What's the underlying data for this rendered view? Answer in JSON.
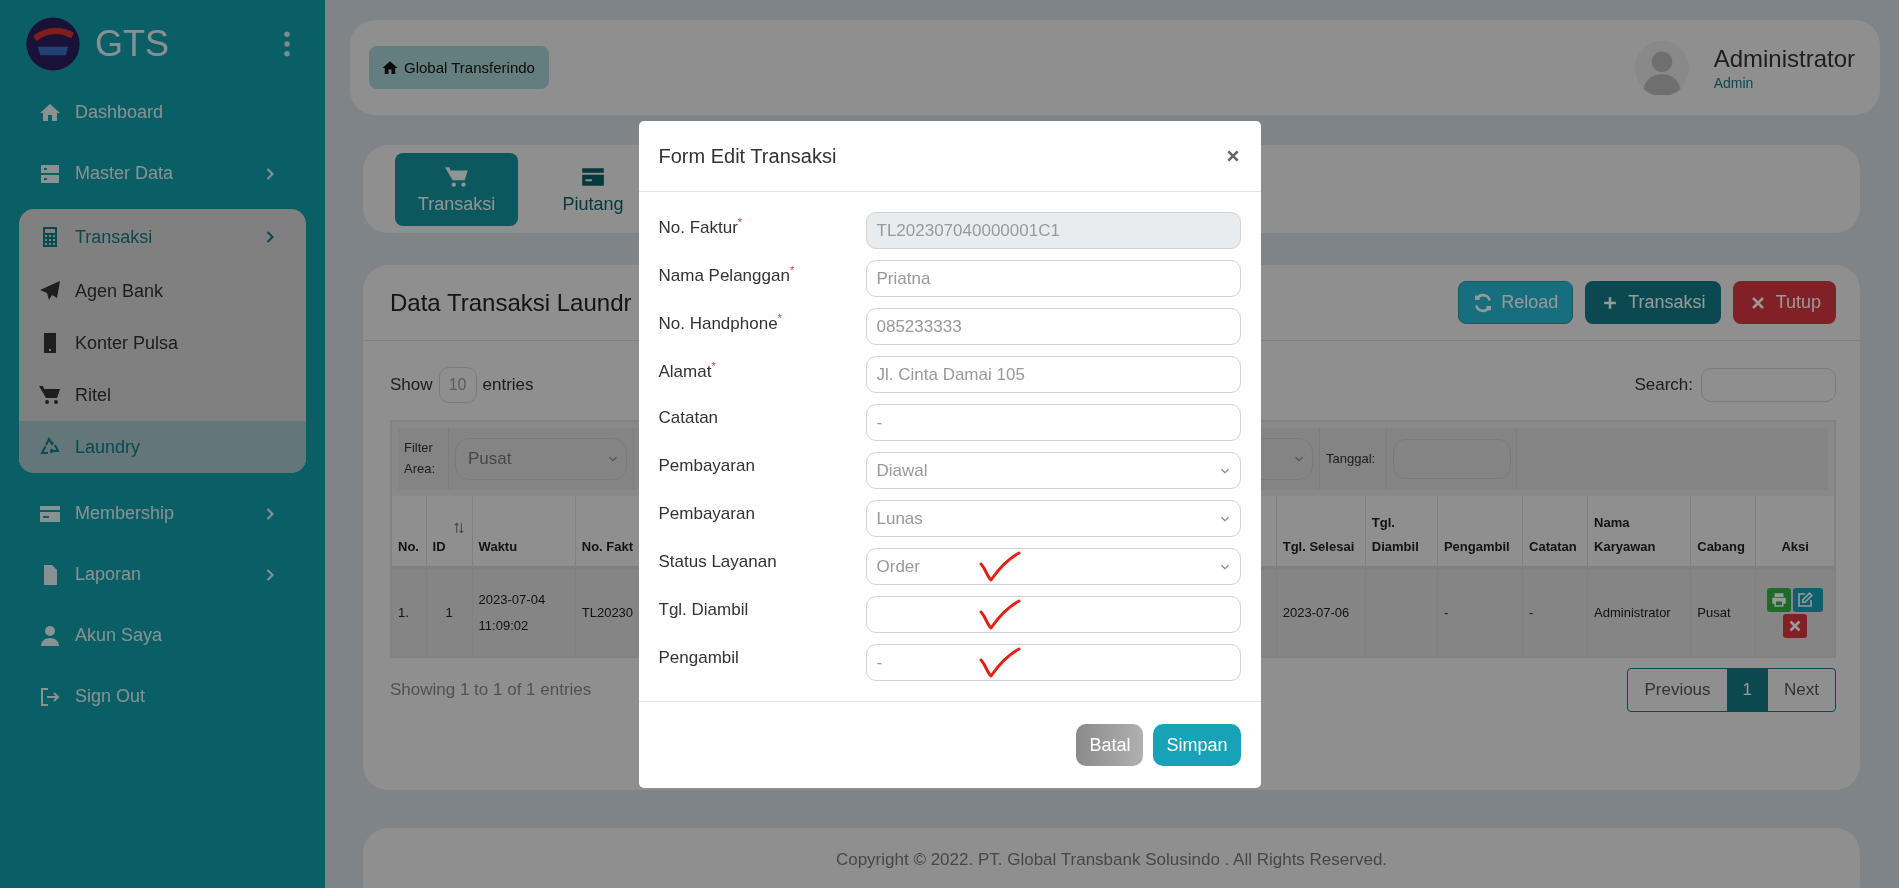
{
  "sidebar": {
    "brand": "GTS",
    "items": [
      {
        "label": "Dashboard",
        "has_submenu": false,
        "selected": false
      },
      {
        "label": "Master Data",
        "has_submenu": true,
        "selected": false
      },
      {
        "label": "Transaksi",
        "has_submenu": true,
        "expanded": true,
        "selected": true,
        "children": [
          {
            "label": "Agen Bank",
            "selected": false
          },
          {
            "label": "Konter Pulsa",
            "selected": false
          },
          {
            "label": "Ritel",
            "selected": false
          },
          {
            "label": "Laundry",
            "selected": true
          }
        ]
      },
      {
        "label": "Membership",
        "has_submenu": true,
        "selected": false
      },
      {
        "label": "Laporan",
        "has_submenu": true,
        "selected": false
      },
      {
        "label": "Akun Saya",
        "has_submenu": false,
        "selected": false
      },
      {
        "label": "Sign Out",
        "has_submenu": false,
        "selected": false
      }
    ]
  },
  "header": {
    "breadcrumb": "Global Transferindo",
    "user": {
      "name": "Administrator",
      "role": "Admin"
    }
  },
  "tabs": [
    {
      "label": "Transaksi",
      "selected": true
    },
    {
      "label": "Piutang",
      "selected": false
    }
  ],
  "panel": {
    "title": "Data Transaksi Laundr",
    "buttons": [
      {
        "label": "Reload",
        "kind": "info"
      },
      {
        "label": "Transaksi",
        "kind": "primary"
      },
      {
        "label": "Tutup",
        "kind": "danger"
      }
    ],
    "length": {
      "before": "Show",
      "value": "10",
      "after": "entries"
    },
    "search": {
      "label": "Search:"
    },
    "filters": {
      "area_label": "Filter Area:",
      "area_value": "Pusat",
      "date_label": "Tanggal:"
    },
    "table": {
      "columns": [
        "No.",
        "ID",
        "Waktu",
        "No. Fakt",
        "Tgl. Selesai",
        "Tgl. Diambil",
        "Pengambil",
        "Catatan",
        "Nama Karyawan",
        "Cabang",
        "Aksi"
      ],
      "rows": [
        {
          "cells": [
            "1.",
            "1",
            "2023-07-04 11:09:02",
            "TL20230",
            "2023-07-06",
            null,
            "-",
            "-",
            "Administrator",
            "Pusat"
          ]
        }
      ]
    },
    "info": "Showing 1 to 1 of 1 entries",
    "pagination": [
      {
        "label": "Previous",
        "selected": false
      },
      {
        "label": "1",
        "selected": true
      },
      {
        "label": "Next",
        "selected": false
      }
    ]
  },
  "modal": {
    "title": "Form Edit Transaksi",
    "fields": [
      {
        "label": "No. Faktur$^{*}$",
        "kind": "input",
        "value": "TL202307040000001C1",
        "disabled": true,
        "marked": false
      },
      {
        "label": "Nama Pelanggan$^{*}$",
        "kind": "input",
        "value": "Priatna",
        "disabled": false,
        "marked": false
      },
      {
        "label": "No. Handphone$^{*}$",
        "kind": "input",
        "value": "085233333",
        "disabled": false,
        "marked": false
      },
      {
        "label": "Alamat$^{*}$",
        "kind": "input",
        "value": "Jl. Cinta Damai 105",
        "disabled": false,
        "marked": false
      },
      {
        "label": "Catatan",
        "kind": "input",
        "value": "-",
        "disabled": false,
        "marked": false
      },
      {
        "label": "Pembayaran",
        "kind": "select",
        "value": "Diawal",
        "disabled": false,
        "marked": false
      },
      {
        "label": "Pembayaran",
        "kind": "select",
        "value": "Lunas",
        "disabled": false,
        "marked": false
      },
      {
        "label": "Status Layanan",
        "kind": "select",
        "value": "Order",
        "disabled": false,
        "marked": true
      },
      {
        "label": "Tgl. Diambil",
        "kind": "input",
        "disabled": false,
        "marked": true
      },
      {
        "label": "Pengambil",
        "kind": "input",
        "value": "-",
        "disabled": false,
        "marked": true
      }
    ],
    "buttons": [
      {
        "label": "Batal",
        "kind": "secondary"
      },
      {
        "label": "Simpan",
        "kind": "primary"
      }
    ]
  },
  "footer": {
    "copyright": "Copyright © 2022. PT. Global Transbank Solusindo . All Rights Reserved."
  }
}
